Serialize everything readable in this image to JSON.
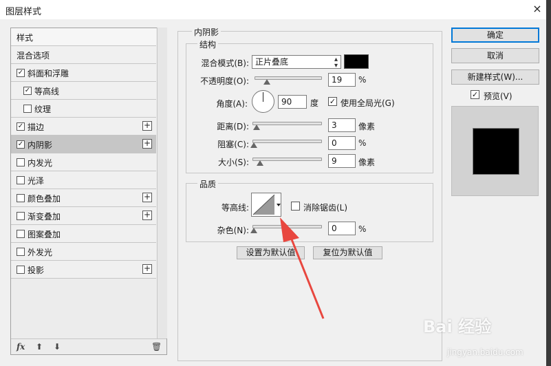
{
  "window": {
    "title": "图层样式",
    "close_icon": "×"
  },
  "style_list": {
    "items": [
      {
        "label": "样式",
        "checkbox": false,
        "checked": false,
        "plus": false,
        "selected": false,
        "indent": false
      },
      {
        "label": "混合选项",
        "checkbox": false,
        "checked": false,
        "plus": false,
        "selected": false,
        "indent": false
      },
      {
        "label": "斜面和浮雕",
        "checkbox": true,
        "checked": true,
        "plus": false,
        "selected": false,
        "indent": false
      },
      {
        "label": "等高线",
        "checkbox": true,
        "checked": true,
        "plus": false,
        "selected": false,
        "indent": true
      },
      {
        "label": "纹理",
        "checkbox": true,
        "checked": false,
        "plus": false,
        "selected": false,
        "indent": true
      },
      {
        "label": "描边",
        "checkbox": true,
        "checked": true,
        "plus": true,
        "selected": false,
        "indent": false
      },
      {
        "label": "内阴影",
        "checkbox": true,
        "checked": true,
        "plus": true,
        "selected": true,
        "indent": false
      },
      {
        "label": "内发光",
        "checkbox": true,
        "checked": false,
        "plus": false,
        "selected": false,
        "indent": false
      },
      {
        "label": "光泽",
        "checkbox": true,
        "checked": false,
        "plus": false,
        "selected": false,
        "indent": false
      },
      {
        "label": "颜色叠加",
        "checkbox": true,
        "checked": false,
        "plus": true,
        "selected": false,
        "indent": false
      },
      {
        "label": "渐变叠加",
        "checkbox": true,
        "checked": false,
        "plus": true,
        "selected": false,
        "indent": false
      },
      {
        "label": "图案叠加",
        "checkbox": true,
        "checked": false,
        "plus": false,
        "selected": false,
        "indent": false
      },
      {
        "label": "外发光",
        "checkbox": true,
        "checked": false,
        "plus": false,
        "selected": false,
        "indent": false
      },
      {
        "label": "投影",
        "checkbox": true,
        "checked": false,
        "plus": true,
        "selected": false,
        "indent": false
      }
    ],
    "footer": {
      "fx_label": "fx",
      "up_icon": "⬆",
      "down_icon": "⬇",
      "trash_icon": "🗑"
    }
  },
  "inner_shadow": {
    "title": "内阴影",
    "structure": {
      "title": "结构",
      "blend_mode_label": "混合模式(B):",
      "blend_mode_value": "正片叠底",
      "shadow_color": "#000000",
      "opacity_label": "不透明度(O):",
      "opacity_value": "19",
      "opacity_unit": "%",
      "angle_label": "角度(A):",
      "angle_value": "90",
      "angle_unit": "度",
      "global_light_label": "使用全局光(G)",
      "global_light_checked": true,
      "distance_label": "距离(D):",
      "distance_value": "3",
      "distance_unit": "像素",
      "choke_label": "阻塞(C):",
      "choke_value": "0",
      "choke_unit": "%",
      "size_label": "大小(S):",
      "size_value": "9",
      "size_unit": "像素"
    },
    "quality": {
      "title": "品质",
      "contour_label": "等高线:",
      "antialias_label": "消除锯齿(L)",
      "antialias_checked": false,
      "noise_label": "杂色(N):",
      "noise_value": "0",
      "noise_unit": "%"
    },
    "make_default_label": "设置为默认值",
    "reset_default_label": "复位为默认值"
  },
  "buttons": {
    "ok_label": "确定",
    "cancel_label": "取消",
    "new_style_label": "新建样式(W)...",
    "preview_label": "预览(V)",
    "preview_checked": true
  },
  "watermark": {
    "logo_text": "Bai 经验",
    "url_text": "jingyan.baidu.com"
  },
  "colors": {
    "annotation_arrow": "#e8473f",
    "selected_item": "#c6c6c6",
    "default_button_border": "#0078d7"
  }
}
